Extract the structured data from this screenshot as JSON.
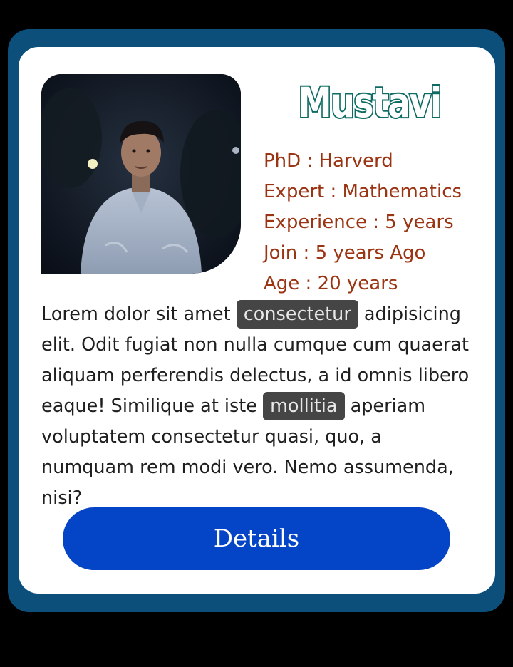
{
  "profile": {
    "name": "Mustavi",
    "photo_alt": "",
    "facts": [
      "PhD : Harverd",
      "Expert : Mathematics",
      "Experience : 5 years",
      "Join : 5 years Ago",
      "Age : 20 years"
    ]
  },
  "bio": {
    "part1": "Lorem dolor sit amet ",
    "tag1": "consectetur",
    "part2": " adipisicing elit. Odit fugiat non nulla cumque cum quaerat aliquam perferendis delectus, a id omnis libero eaque! Similique at iste ",
    "tag2": "mollitia",
    "part3": " aperiam voluptatem consectetur quasi, quo, a numquam rem modi vero. Nemo assumenda, nisi?"
  },
  "actions": {
    "details_label": "Details"
  },
  "colors": {
    "frame": "#0b4f7a",
    "card": "#ffffff",
    "name_stroke": "#0d6b63",
    "fact_text": "#9a3412",
    "tag_bg": "#454545",
    "button": "#0445c7"
  }
}
